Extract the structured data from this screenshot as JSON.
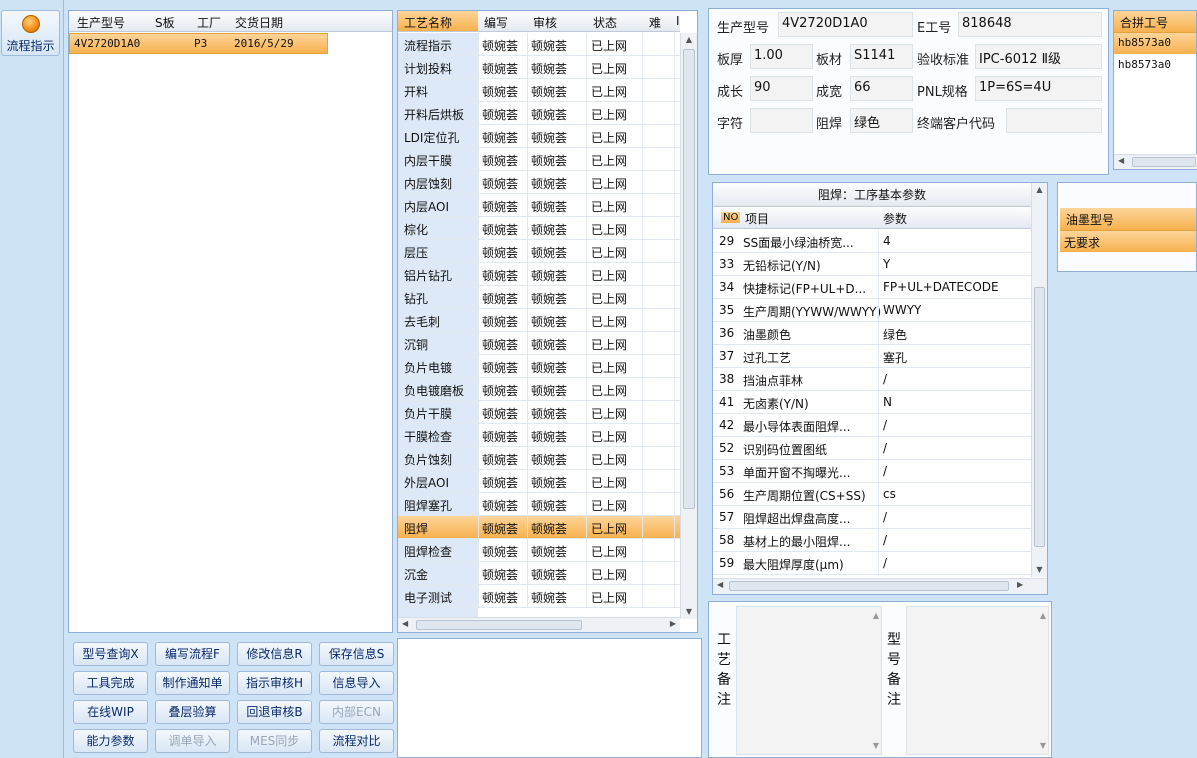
{
  "sidebar": {
    "label": "流程指示"
  },
  "products": {
    "headers": [
      "生产型号",
      "S板",
      "工厂",
      "交货日期"
    ],
    "rows": [
      {
        "model": "4V2720D1A0",
        "s": "",
        "factory": "P3",
        "date": "2016/5/29"
      }
    ]
  },
  "process": {
    "headers": [
      "工艺名称",
      "编写",
      "审核",
      "状态",
      "难",
      "I"
    ],
    "rows": [
      {
        "name": "流程指示",
        "writer": "顿婉荟",
        "reviewer": "顿婉荟",
        "status": "已上网"
      },
      {
        "name": "计划投料",
        "writer": "顿婉荟",
        "reviewer": "顿婉荟",
        "status": "已上网"
      },
      {
        "name": "开料",
        "writer": "顿婉荟",
        "reviewer": "顿婉荟",
        "status": "已上网"
      },
      {
        "name": "开料后烘板",
        "writer": "顿婉荟",
        "reviewer": "顿婉荟",
        "status": "已上网"
      },
      {
        "name": "LDI定位孔",
        "writer": "顿婉荟",
        "reviewer": "顿婉荟",
        "status": "已上网"
      },
      {
        "name": "内层干膜",
        "writer": "顿婉荟",
        "reviewer": "顿婉荟",
        "status": "已上网"
      },
      {
        "name": "内层蚀刻",
        "writer": "顿婉荟",
        "reviewer": "顿婉荟",
        "status": "已上网"
      },
      {
        "name": "内层AOI",
        "writer": "顿婉荟",
        "reviewer": "顿婉荟",
        "status": "已上网"
      },
      {
        "name": "棕化",
        "writer": "顿婉荟",
        "reviewer": "顿婉荟",
        "status": "已上网"
      },
      {
        "name": "层压",
        "writer": "顿婉荟",
        "reviewer": "顿婉荟",
        "status": "已上网"
      },
      {
        "name": "铝片钻孔",
        "writer": "顿婉荟",
        "reviewer": "顿婉荟",
        "status": "已上网"
      },
      {
        "name": "钻孔",
        "writer": "顿婉荟",
        "reviewer": "顿婉荟",
        "status": "已上网"
      },
      {
        "name": "去毛刺",
        "writer": "顿婉荟",
        "reviewer": "顿婉荟",
        "status": "已上网"
      },
      {
        "name": "沉铜",
        "writer": "顿婉荟",
        "reviewer": "顿婉荟",
        "status": "已上网"
      },
      {
        "name": "负片电镀",
        "writer": "顿婉荟",
        "reviewer": "顿婉荟",
        "status": "已上网"
      },
      {
        "name": "负电镀磨板",
        "writer": "顿婉荟",
        "reviewer": "顿婉荟",
        "status": "已上网"
      },
      {
        "name": "负片干膜",
        "writer": "顿婉荟",
        "reviewer": "顿婉荟",
        "status": "已上网"
      },
      {
        "name": "干膜检查",
        "writer": "顿婉荟",
        "reviewer": "顿婉荟",
        "status": "已上网"
      },
      {
        "name": "负片蚀刻",
        "writer": "顿婉荟",
        "reviewer": "顿婉荟",
        "status": "已上网"
      },
      {
        "name": "外层AOI",
        "writer": "顿婉荟",
        "reviewer": "顿婉荟",
        "status": "已上网"
      },
      {
        "name": "阻焊塞孔",
        "writer": "顿婉荟",
        "reviewer": "顿婉荟",
        "status": "已上网"
      },
      {
        "name": "阻焊",
        "writer": "顿婉荟",
        "reviewer": "顿婉荟",
        "status": "已上网"
      },
      {
        "name": "阻焊检查",
        "writer": "顿婉荟",
        "reviewer": "顿婉荟",
        "status": "已上网"
      },
      {
        "name": "沉金",
        "writer": "顿婉荟",
        "reviewer": "顿婉荟",
        "status": "已上网"
      },
      {
        "name": "电子测试",
        "writer": "顿婉荟",
        "reviewer": "顿婉荟",
        "status": "已上网"
      }
    ],
    "selected_index": 21
  },
  "buttons": [
    [
      "型号查询X",
      "编写流程F",
      "修改信息R",
      "保存信息S"
    ],
    [
      "工具完成",
      "制作通知单",
      "指示审核H",
      "信息导入"
    ],
    [
      "在线WIP",
      "叠层验算",
      "回退审核B",
      "内部ECN"
    ],
    [
      "能力参数",
      "调单导入",
      "MES同步",
      "流程对比"
    ]
  ],
  "buttons_disabled": [
    "内部ECN",
    "调单导入",
    "MES同步"
  ],
  "info": {
    "model_label": "生产型号",
    "model": "4V2720D1A0",
    "e_label": "E工号",
    "e_no": "818648",
    "thick_label": "板厚",
    "thick": "1.00",
    "mat_label": "板材",
    "mat": "S1141",
    "std_label": "验收标准",
    "std": "IPC-6012 Ⅱ级",
    "len_label": "成长",
    "len": "90",
    "wid_label": "成宽",
    "wid": "66",
    "pnl_label": "PNL规格",
    "pnl": "1P=6S=4U",
    "char_label": "字符",
    "char": "",
    "mask_label": "阻焊",
    "mask": "绿色",
    "cust_label": "终端客户代码",
    "cust": ""
  },
  "merge": {
    "header": "合拼工号",
    "items": [
      "hb8573a0",
      "hb8573a0"
    ]
  },
  "params": {
    "title": "阻焊：工序基本参数",
    "headers": [
      "NO",
      "项目",
      "参数"
    ],
    "rows": [
      {
        "no": "29",
        "item": "SS面最小绿油桥宽...",
        "val": "4"
      },
      {
        "no": "33",
        "item": "无铅标记(Y/N)",
        "val": "Y"
      },
      {
        "no": "34",
        "item": "快捷标记(FP+UL+D...",
        "val": "FP+UL+DATECODE"
      },
      {
        "no": "35",
        "item": "生产周期(YYWW/WWYY)",
        "val": "WWYY"
      },
      {
        "no": "36",
        "item": "油墨颜色",
        "val": "绿色"
      },
      {
        "no": "37",
        "item": "过孔工艺",
        "val": "塞孔"
      },
      {
        "no": "38",
        "item": "挡油点菲林",
        "val": "/"
      },
      {
        "no": "41",
        "item": "无卤素(Y/N)",
        "val": "N"
      },
      {
        "no": "42",
        "item": "最小导体表面阻焊...",
        "val": "/"
      },
      {
        "no": "52",
        "item": "识别码位置图纸",
        "val": "/"
      },
      {
        "no": "53",
        "item": "单面开窗不掏曝光...",
        "val": "/"
      },
      {
        "no": "56",
        "item": "生产周期位置(CS+SS)",
        "val": "cs"
      },
      {
        "no": "57",
        "item": "阻焊超出焊盘高度...",
        "val": "/"
      },
      {
        "no": "58",
        "item": "基材上的最小阻焊...",
        "val": "/"
      },
      {
        "no": "59",
        "item": "最大阻焊厚度(μm)",
        "val": "/"
      }
    ]
  },
  "ink": {
    "header": "油墨型号",
    "value": "无要求"
  },
  "remarks": {
    "process_label": "工艺备注",
    "model_label": "型号备注"
  }
}
